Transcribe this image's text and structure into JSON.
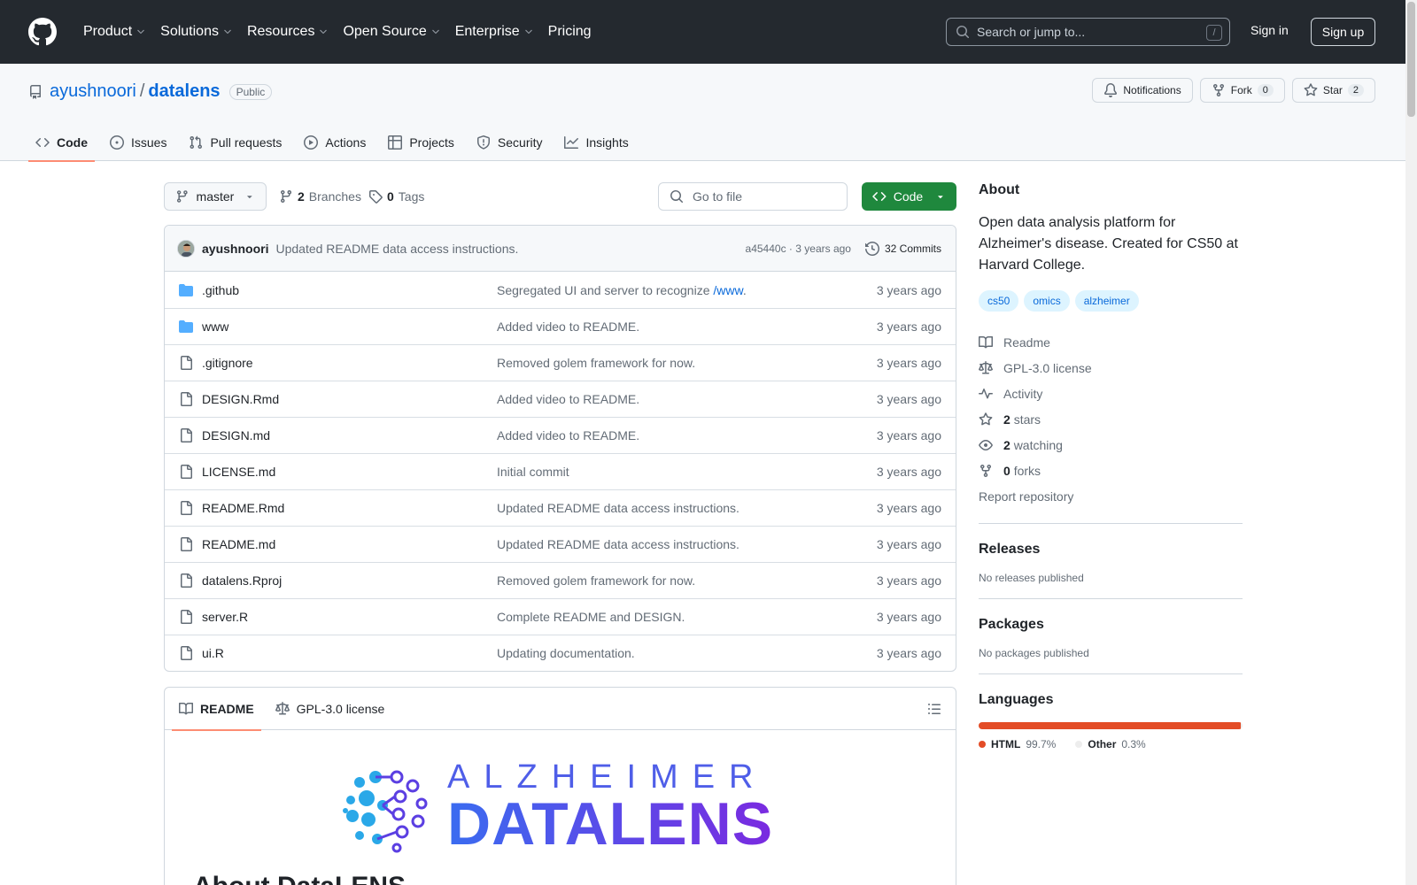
{
  "header": {
    "nav": [
      "Product",
      "Solutions",
      "Resources",
      "Open Source",
      "Enterprise",
      "Pricing"
    ],
    "search_placeholder": "Search or jump to...",
    "search_shortcut": "/",
    "sign_in": "Sign in",
    "sign_up": "Sign up"
  },
  "repo": {
    "owner": "ayushnoori",
    "separator": "/",
    "name": "datalens",
    "visibility": "Public",
    "notifications_label": "Notifications",
    "fork_label": "Fork",
    "fork_count": "0",
    "star_label": "Star",
    "star_count": "2",
    "tabs": [
      "Code",
      "Issues",
      "Pull requests",
      "Actions",
      "Projects",
      "Security",
      "Insights"
    ]
  },
  "toolbar": {
    "branch": "master",
    "branches_count": "2",
    "branches_label": "Branches",
    "tags_count": "0",
    "tags_label": "Tags",
    "goto_placeholder": "Go to file",
    "code_button": "Code"
  },
  "latest_commit": {
    "author": "ayushnoori",
    "message": "Updated README data access instructions.",
    "hash": "a45440c",
    "dot": "·",
    "time": "3 years ago",
    "commits_label": "32 Commits"
  },
  "files": [
    {
      "name": ".github",
      "type": "folder",
      "message": "Segregated UI and server to recognize ",
      "link": "/www",
      "suffix": ".",
      "date": "3 years ago"
    },
    {
      "name": "www",
      "type": "folder",
      "message": "Added video to README.",
      "link": "",
      "suffix": "",
      "date": "3 years ago"
    },
    {
      "name": ".gitignore",
      "type": "file",
      "message": "Removed golem framework for now.",
      "link": "",
      "suffix": "",
      "date": "3 years ago"
    },
    {
      "name": "DESIGN.Rmd",
      "type": "file",
      "message": "Added video to README.",
      "link": "",
      "suffix": "",
      "date": "3 years ago"
    },
    {
      "name": "DESIGN.md",
      "type": "file",
      "message": "Added video to README.",
      "link": "",
      "suffix": "",
      "date": "3 years ago"
    },
    {
      "name": "LICENSE.md",
      "type": "file",
      "message": "Initial commit",
      "link": "",
      "suffix": "",
      "date": "3 years ago"
    },
    {
      "name": "README.Rmd",
      "type": "file",
      "message": "Updated README data access instructions.",
      "link": "",
      "suffix": "",
      "date": "3 years ago"
    },
    {
      "name": "README.md",
      "type": "file",
      "message": "Updated README data access instructions.",
      "link": "",
      "suffix": "",
      "date": "3 years ago"
    },
    {
      "name": "datalens.Rproj",
      "type": "file",
      "message": "Removed golem framework for now.",
      "link": "",
      "suffix": "",
      "date": "3 years ago"
    },
    {
      "name": "server.R",
      "type": "file",
      "message": "Complete README and DESIGN.",
      "link": "",
      "suffix": "",
      "date": "3 years ago"
    },
    {
      "name": "ui.R",
      "type": "file",
      "message": "Updating documentation.",
      "link": "",
      "suffix": "",
      "date": "3 years ago"
    }
  ],
  "readme": {
    "tab_readme": "README",
    "tab_license": "GPL-3.0 license",
    "logo_line1": "ALZHEIMER",
    "logo_line2": "DATALENS",
    "heading": "About DataLENS"
  },
  "sidebar": {
    "about_title": "About",
    "description": "Open data analysis platform for Alzheimer's disease. Created for CS50 at Harvard College.",
    "topics": [
      "cs50",
      "omics",
      "alzheimer"
    ],
    "links": {
      "readme": "Readme",
      "license": "GPL-3.0 license",
      "activity": "Activity",
      "stars_count": "2",
      "stars_label": "stars",
      "watching_count": "2",
      "watching_label": "watching",
      "forks_count": "0",
      "forks_label": "forks",
      "report": "Report repository"
    },
    "releases_title": "Releases",
    "releases_text": "No releases published",
    "packages_title": "Packages",
    "packages_text": "No packages published",
    "languages_title": "Languages",
    "languages": [
      {
        "name": "HTML",
        "percent": "99.7%",
        "fraction": 0.997,
        "color": "#e34c26"
      },
      {
        "name": "Other",
        "percent": "0.3%",
        "fraction": 0.003,
        "color": "#ededed"
      }
    ]
  }
}
